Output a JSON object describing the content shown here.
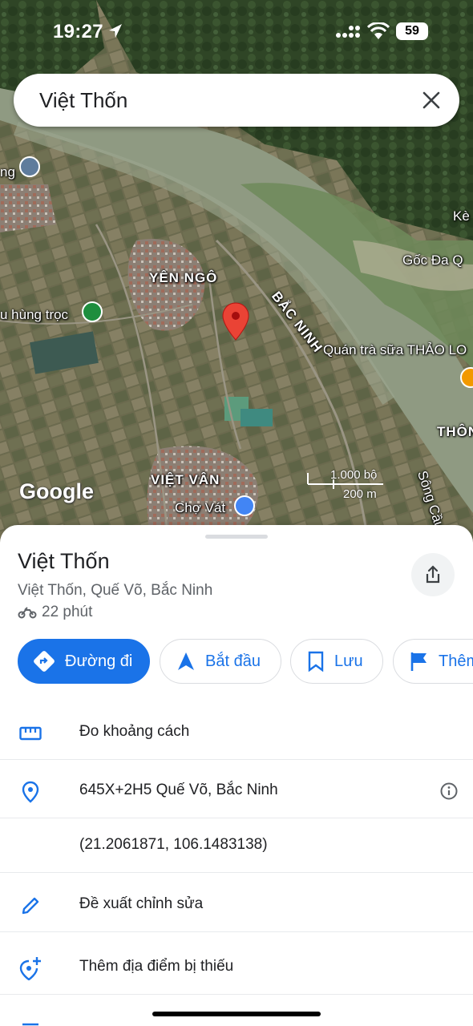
{
  "status_bar": {
    "time": "19:27",
    "battery": "59"
  },
  "search": {
    "query": "Việt Thốn"
  },
  "map": {
    "labels": {
      "yen_ngo": "YÊN NGÔ",
      "bac_ninh": "BẮC NINH",
      "hung_troc": "u hùng trọc",
      "quan_tra_sua": "Quán trà sữa THẢO LO",
      "goc_da": "Gốc Đa Q",
      "ke": "Kè",
      "thon": "THÔN",
      "viet_van": "VIỆT VÂN",
      "cho_vat": "Chợ Vát",
      "song_cau": "Sông Cầu",
      "left_edge": "ng"
    },
    "logo": "Google",
    "scale_top": "1.000 bộ",
    "scale_bottom": "200 m"
  },
  "place": {
    "title": "Việt Thốn",
    "address": "Việt Thốn, Quế Võ, Bắc Ninh",
    "travel_time": "22 phút"
  },
  "actions": {
    "directions": "Đường đi",
    "start": "Bắt đầu",
    "save": "Lưu",
    "more": "Thêm"
  },
  "details": {
    "measure": "Đo khoảng cách",
    "plus_code": "645X+2H5 Quế Võ, Bắc Ninh",
    "coordinates": "(21.2061871, 106.1483138)",
    "suggest_edit": "Đề xuất chỉnh sửa",
    "add_missing": "Thêm địa điểm bị thiếu"
  },
  "colors": {
    "accent": "#1a73e8",
    "pin": "#ea4335"
  },
  "icons": [
    "location-arrow-icon",
    "close-icon",
    "share-icon",
    "motorbike-icon",
    "directions-icon",
    "navigate-icon",
    "bookmark-icon",
    "flag-icon",
    "ruler-icon",
    "location-pin-icon",
    "info-icon",
    "pencil-icon",
    "add-location-icon"
  ]
}
